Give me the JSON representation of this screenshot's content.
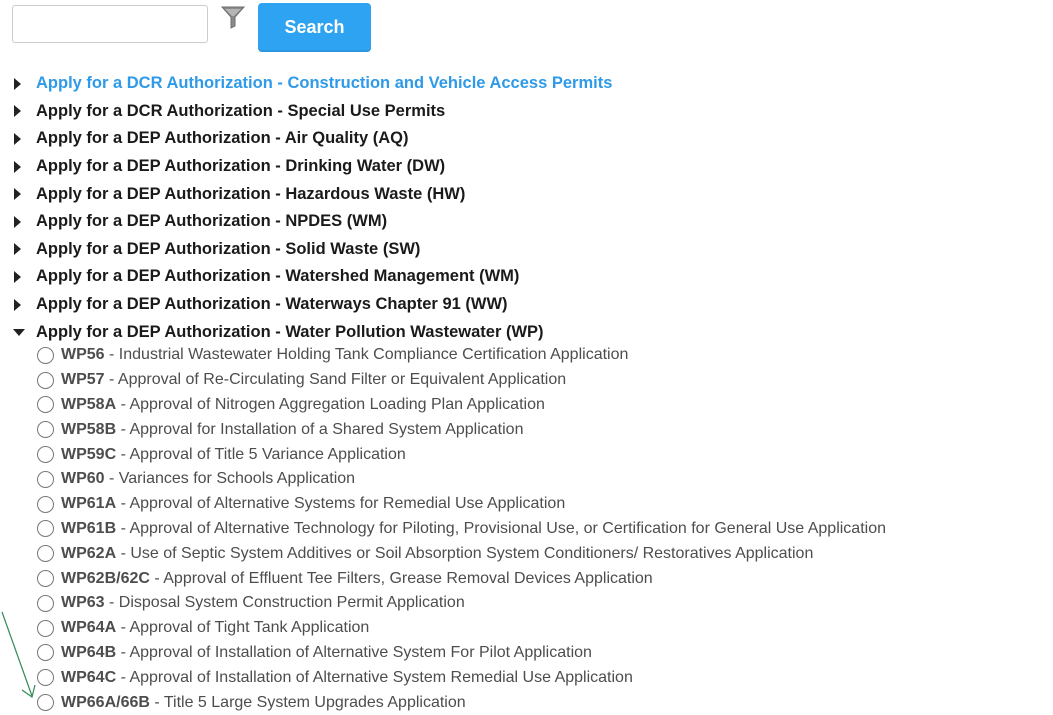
{
  "search": {
    "value": "",
    "placeholder": "",
    "button_label": "Search"
  },
  "colors": {
    "accent": "#2ea3f2",
    "link_active": "#2e9ae8",
    "annotation_arrow": "#2e8b57"
  },
  "categories": [
    {
      "label": "Apply for a DCR Authorization - Construction and Vehicle Access Permits",
      "expanded": false,
      "active": true
    },
    {
      "label": "Apply for a DCR Authorization - Special Use Permits",
      "expanded": false
    },
    {
      "label": "Apply for a DEP Authorization - Air Quality (AQ)",
      "expanded": false
    },
    {
      "label": "Apply for a DEP Authorization - Drinking Water (DW)",
      "expanded": false
    },
    {
      "label": "Apply for a DEP Authorization - Hazardous Waste (HW)",
      "expanded": false
    },
    {
      "label": "Apply for a DEP Authorization - NPDES (WM)",
      "expanded": false
    },
    {
      "label": "Apply for a DEP Authorization - Solid Waste (SW)",
      "expanded": false
    },
    {
      "label": "Apply for a DEP Authorization - Watershed Management (WM)",
      "expanded": false
    },
    {
      "label": "Apply for a DEP Authorization - Waterways Chapter 91 (WW)",
      "expanded": false
    },
    {
      "label": "Apply for a DEP Authorization - Water Pollution Wastewater (WP)",
      "expanded": true
    }
  ],
  "wp_items": [
    {
      "code": "WP56",
      "title": " - Industrial Wastewater Holding Tank Compliance Certification Application"
    },
    {
      "code": "WP57",
      "title": " - Approval of Re-Circulating Sand Filter or Equivalent Application"
    },
    {
      "code": "WP58A",
      "title": " - Approval of Nitrogen Aggregation Loading Plan Application"
    },
    {
      "code": "WP58B",
      "title": " - Approval for Installation of a Shared System Application"
    },
    {
      "code": "WP59C",
      "title": " - Approval of Title 5 Variance Application"
    },
    {
      "code": "WP60",
      "title": " - Variances for Schools Application"
    },
    {
      "code": "WP61A",
      "title": " - Approval of Alternative Systems for Remedial Use Application"
    },
    {
      "code": "WP61B",
      "title": " - Approval of Alternative Technology for Piloting, Provisional Use, or Certification for General Use Application"
    },
    {
      "code": "WP62A",
      "title": " - Use of Septic System Additives or Soil Absorption System Conditioners/ Restoratives Application"
    },
    {
      "code": "WP62B/62C",
      "title": " - Approval of Effluent Tee Filters, Grease Removal Devices Application"
    },
    {
      "code": "WP63",
      "title": " - Disposal System Construction Permit Application"
    },
    {
      "code": "WP64A",
      "title": " - Approval of Tight Tank Application"
    },
    {
      "code": "WP64B",
      "title": " - Approval of Installation of Alternative System For Pilot Application"
    },
    {
      "code": "WP64C",
      "title": " - Approval of Installation of Alternative System Remedial Use Application"
    },
    {
      "code": "WP66A/66B",
      "title": " - Title 5 Large System Upgrades Application"
    }
  ]
}
